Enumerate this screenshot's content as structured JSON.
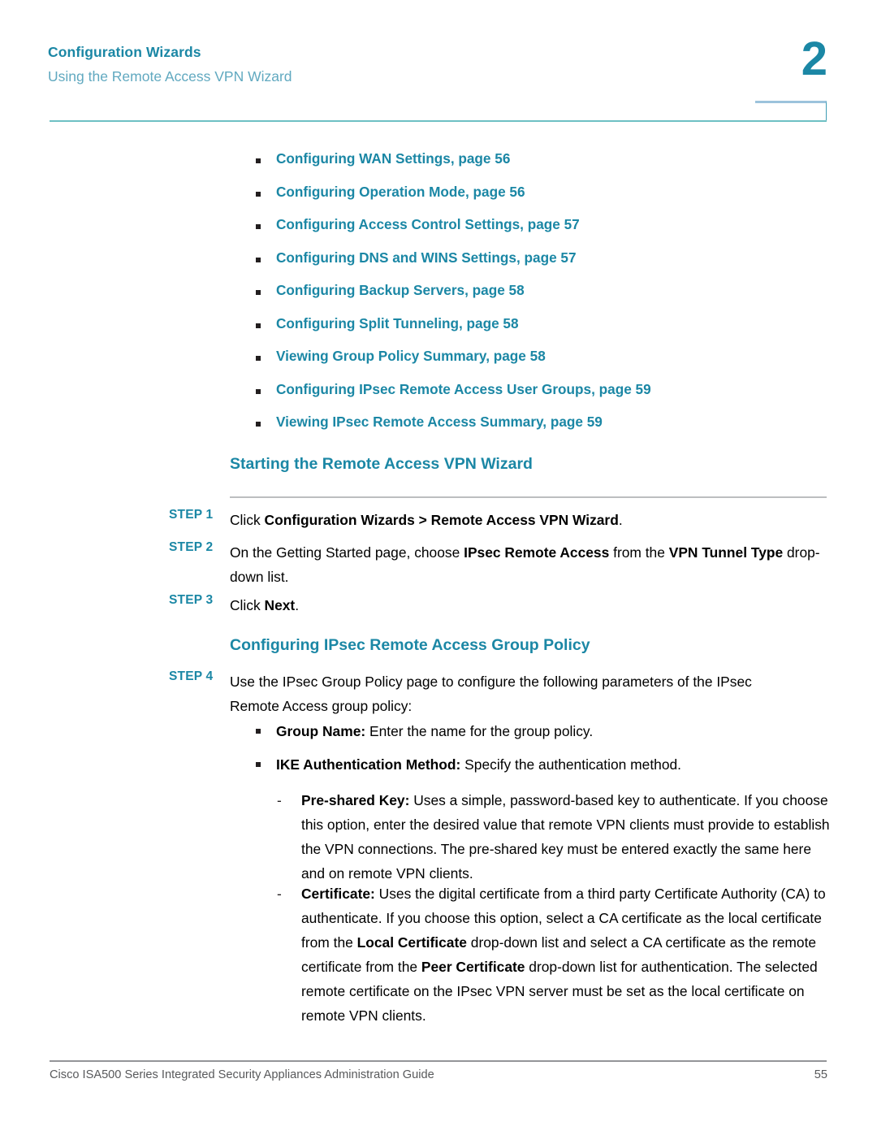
{
  "header": {
    "chapter_title": "Configuration Wizards",
    "section_title": "Using the Remote Access VPN Wizard",
    "chapter_number": "2"
  },
  "colors": {
    "accent_teal": "#1b87a5",
    "light_teal": "#61a9c0",
    "rule_teal": "#6ec0c4",
    "box_blue": "#9cc3dc",
    "grey_rule": "#bcbec0",
    "footer_grey": "#58595b"
  },
  "toc": {
    "items": [
      {
        "label": "Configuring WAN Settings, page 56"
      },
      {
        "label": "Configuring Operation Mode, page 56"
      },
      {
        "label": "Configuring Access Control Settings, page 57"
      },
      {
        "label": "Configuring DNS and WINS Settings, page 57"
      },
      {
        "label": "Configuring Backup Servers, page 58"
      },
      {
        "label": "Configuring Split Tunneling, page 58"
      },
      {
        "label": "Viewing Group Policy Summary, page 58"
      },
      {
        "label": "Configuring IPsec Remote Access User Groups, page 59"
      },
      {
        "label": "Viewing IPsec Remote Access Summary, page 59"
      }
    ]
  },
  "sections": {
    "starting_heading": "Starting the Remote Access VPN Wizard",
    "configuring_heading": "Configuring IPsec Remote Access Group Policy"
  },
  "steps": {
    "step1": {
      "label": "STEP 1",
      "text_1": "Click ",
      "bold_1": "Configuration Wizards > Remote Access VPN Wizard",
      "text_2": "."
    },
    "step2": {
      "label": "STEP 2",
      "text_1": "On the Getting Started page, choose ",
      "bold_1": "IPsec Remote Access",
      "text_2": " from the ",
      "bold_2": "VPN Tunnel Type",
      "text_3": " drop-down list."
    },
    "step3": {
      "label": "STEP 3",
      "text_1": "Click ",
      "bold_1": "Next",
      "text_2": "."
    },
    "step4": {
      "label": "STEP 4",
      "text_1": "Use the IPsec Group Policy page to configure the following parameters of the IPsec Remote Access group policy:"
    }
  },
  "body_bullets": {
    "group_name": {
      "bold": "Group Name:",
      "text": " Enter the name for the group policy."
    },
    "ike_auth": {
      "bold": "IKE Authentication Method:",
      "text": " Specify the authentication method."
    },
    "pre_shared_key": {
      "bold": "Pre-shared Key:",
      "text": " Uses a simple, password-based key to authenticate. If you choose this option, enter the desired value that remote VPN clients must provide to establish the VPN connections. The pre-shared key must be entered exactly the same here and on remote VPN clients."
    },
    "certificate": {
      "bold_1": "Certificate:",
      "text_1": " Uses the digital certificate from a third party Certificate Authority (CA) to authenticate. If you choose this option, select a CA certificate as the local certificate from the ",
      "bold_2": "Local Certificate",
      "text_2": " drop-down list and select a CA certificate as the remote certificate from the ",
      "bold_3": "Peer Certificate",
      "text_3": " drop-down list for authentication. The selected remote certificate on the IPsec VPN server must be set as the local certificate on remote VPN clients."
    }
  },
  "footer": {
    "guide_title": "Cisco ISA500 Series Integrated Security Appliances Administration Guide",
    "page_number": "55"
  }
}
